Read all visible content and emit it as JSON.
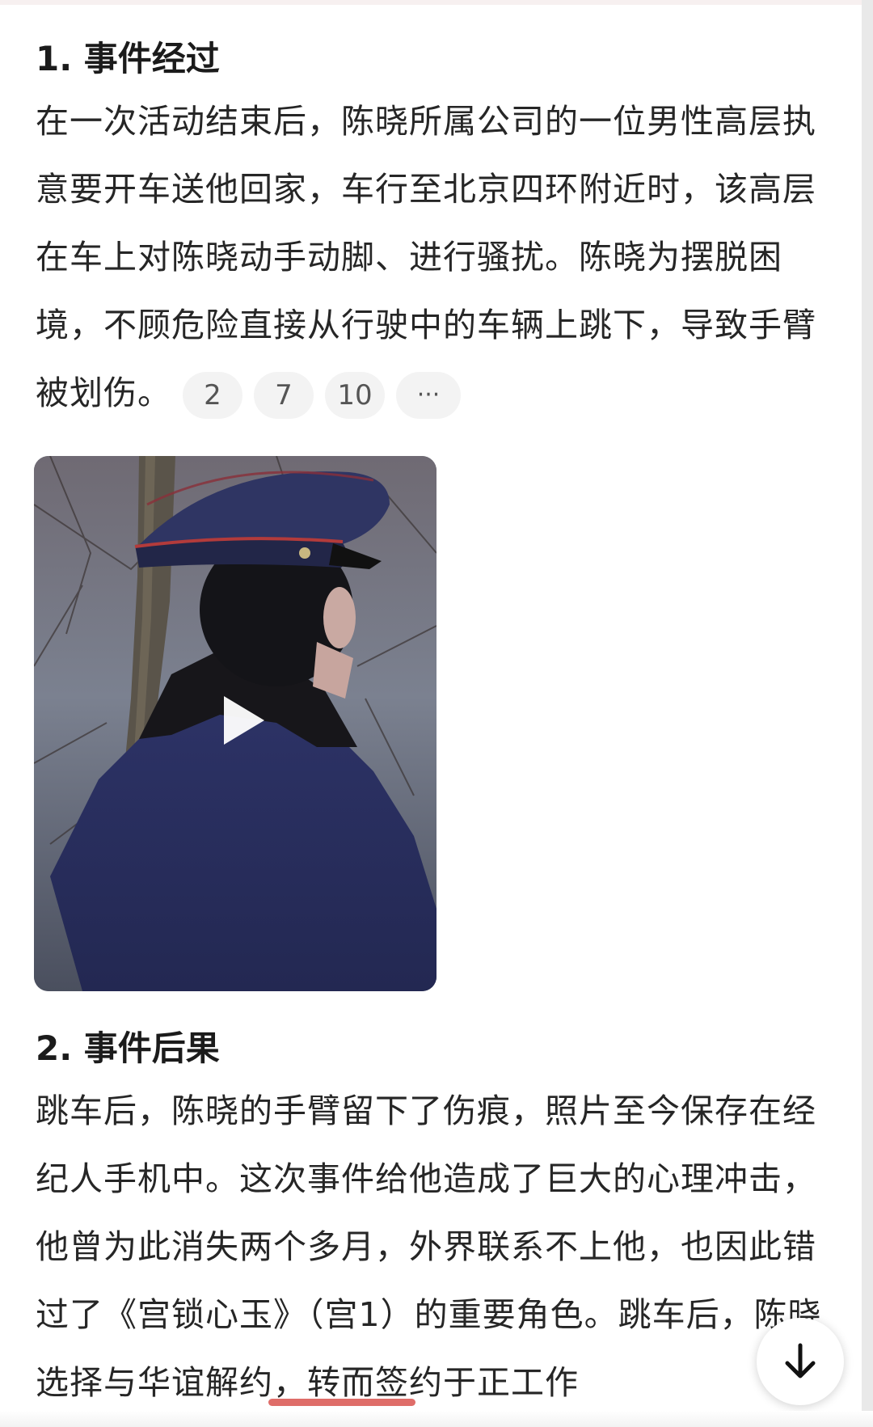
{
  "section1": {
    "heading": "1. 事件经过",
    "text": "在一次活动结束后，陈晓所属公司的一位男性高层执意要开车送他回家，车行至北京四环附近时，该高层在车上对陈晓动手动脚、进行骚扰。陈晓为摆脱困境，不顾危险直接从行驶中的车辆上跳下，导致手臂被划伤。",
    "refs": [
      "2",
      "7",
      "10"
    ],
    "more_label": "···"
  },
  "video": {
    "play_icon": "play-icon"
  },
  "section2": {
    "heading": "2. 事件后果",
    "text": "跳车后，陈晓的手臂留下了伤痕，照片至今保存在经纪人手机中。这次事件给他造成了巨大的心理冲击，他曾为此消失两个多月，外界联系不上他，也因此错过了《宫锁心玉》（宫1）的重要角色。跳车后，陈晓选择与华谊解约，转而签约于正工作"
  },
  "controls": {
    "scroll_down_icon": "arrow-down-icon"
  },
  "colors": {
    "chip_bg": "#f3f3f3",
    "indicator": "#d9534f"
  }
}
